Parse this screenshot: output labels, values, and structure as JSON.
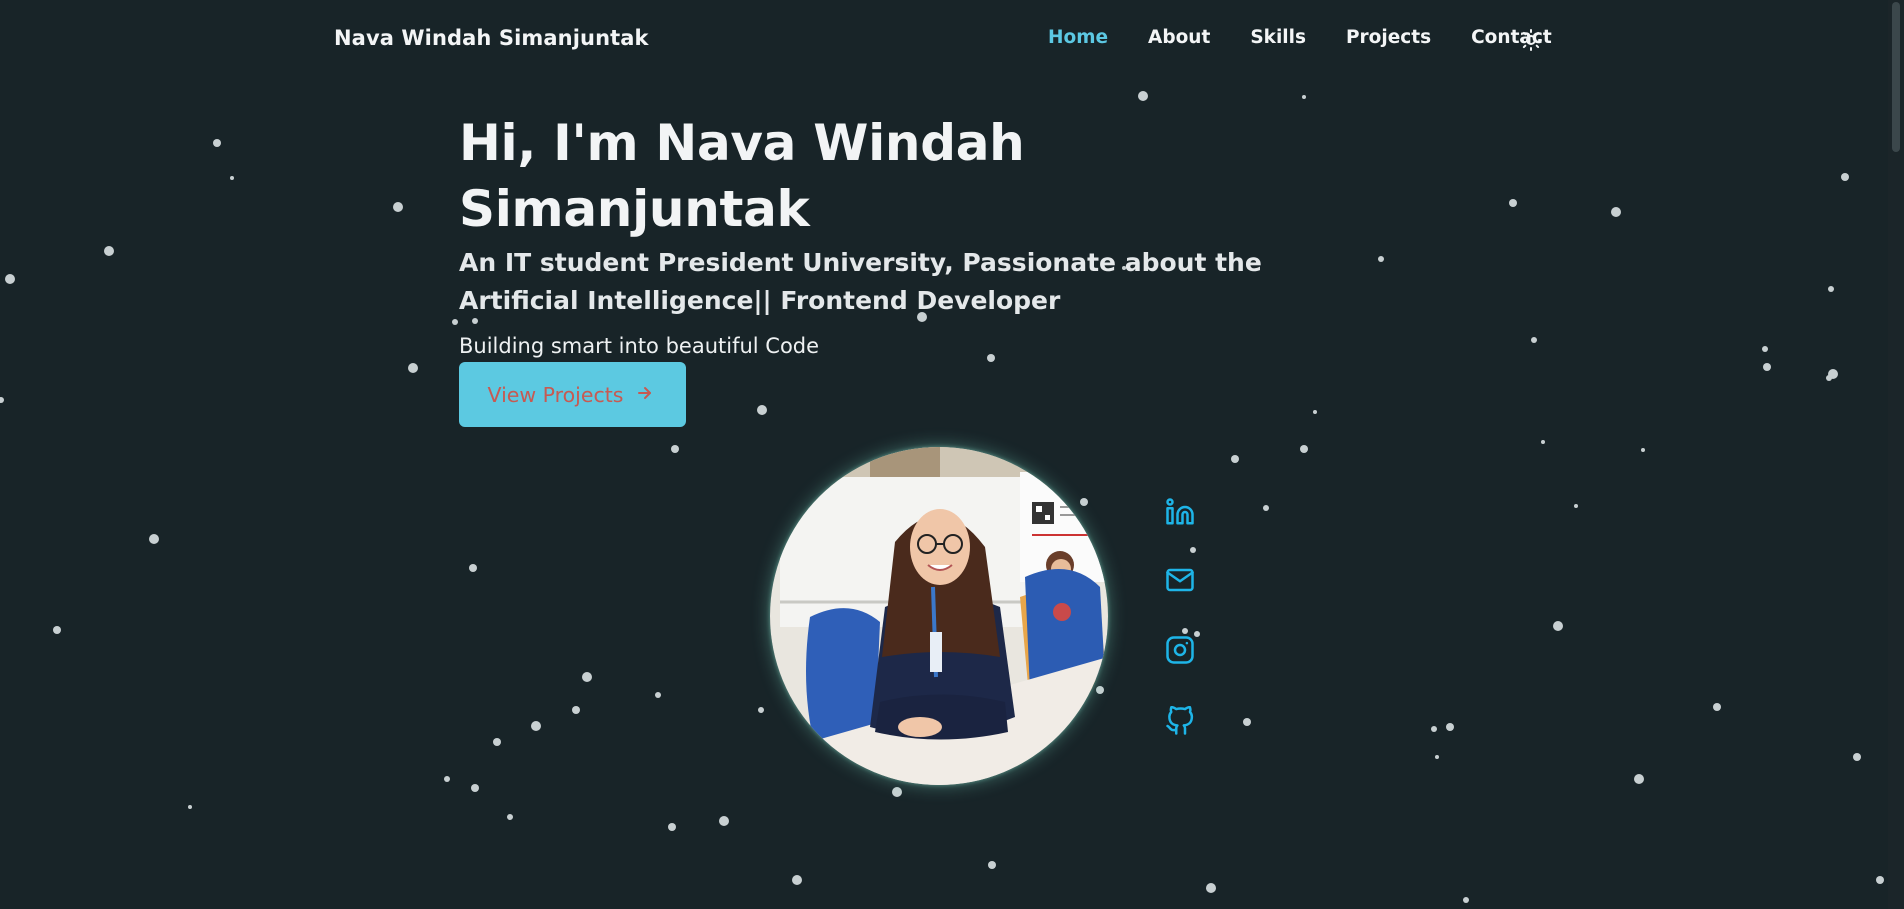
{
  "brand": "Nava Windah Simanjuntak",
  "nav": {
    "items": [
      {
        "label": "Home",
        "active": true
      },
      {
        "label": "About",
        "active": false
      },
      {
        "label": "Skills",
        "active": false
      },
      {
        "label": "Projects",
        "active": false
      },
      {
        "label": "Contact",
        "active": false
      }
    ],
    "theme_toggle_icon": "sun-icon"
  },
  "hero": {
    "title": "Hi, I'm Nava Windah Simanjuntak",
    "subtitle": "An IT student President University, Passionate about the Artificial Intelligence|| Frontend Developer",
    "tagline": "Building smart into beautiful Code",
    "cta_label": "View Projects",
    "cta_icon": "arrow-right-icon"
  },
  "profile_photo_icon": "profile-photo",
  "social": [
    {
      "icon": "linkedin-icon"
    },
    {
      "icon": "mail-icon"
    },
    {
      "icon": "instagram-icon"
    },
    {
      "icon": "github-icon"
    }
  ],
  "colors": {
    "background": "#182428",
    "accent": "#5cc8e3",
    "button_bg": "#5cc9e1",
    "button_text": "#c75a52",
    "social_icon": "#1eb5e8",
    "text": "#f2f4f5"
  }
}
